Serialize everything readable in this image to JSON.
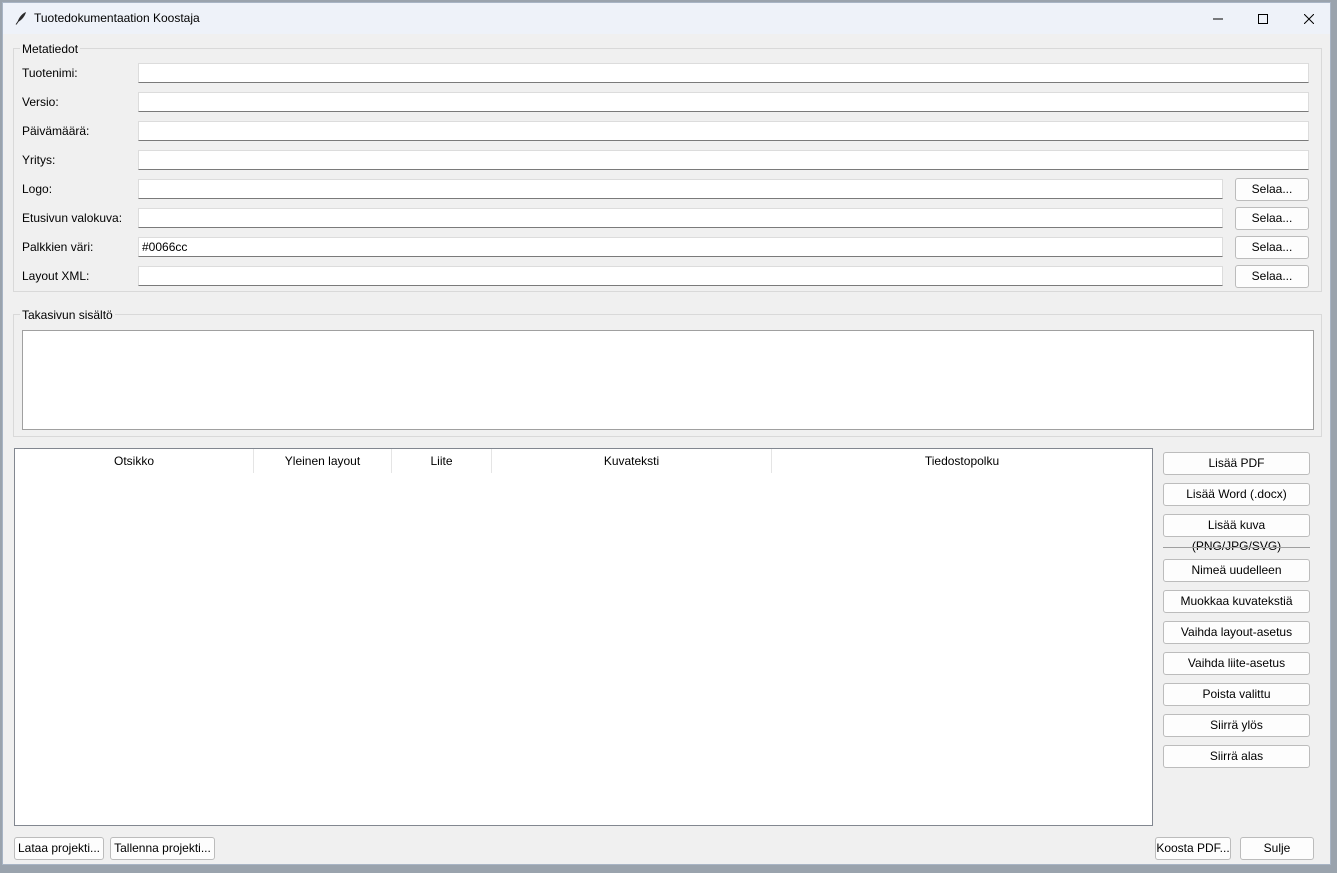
{
  "window": {
    "title": "Tuotedokumentaation Koostaja"
  },
  "metadata": {
    "group_label": "Metatiedot",
    "fields": [
      {
        "label": "Tuotenimi:",
        "value": ""
      },
      {
        "label": "Versio:",
        "value": ""
      },
      {
        "label": "Päivämäärä:",
        "value": ""
      },
      {
        "label": "Yritys:",
        "value": ""
      },
      {
        "label": "Logo:",
        "value": "",
        "browse": "Selaa..."
      },
      {
        "label": "Etusivun valokuva:",
        "value": "",
        "browse": "Selaa..."
      },
      {
        "label": "Palkkien väri:",
        "value": "#0066cc",
        "browse": "Selaa..."
      },
      {
        "label": "Layout XML:",
        "value": "",
        "browse": "Selaa..."
      }
    ]
  },
  "backpage": {
    "group_label": "Takasivun sisältö",
    "value": ""
  },
  "table": {
    "columns": [
      "Otsikko",
      "Yleinen layout",
      "Liite",
      "Kuvateksti",
      "Tiedostopolku"
    ],
    "rows": []
  },
  "side_buttons": {
    "add_pdf": "Lisää PDF",
    "add_word": "Lisää Word (.docx)",
    "add_image": "Lisää kuva (PNG/JPG/SVG)",
    "rename": "Nimeä uudelleen",
    "edit_caption": "Muokkaa kuvatekstiä",
    "toggle_layout": "Vaihda layout-asetus",
    "toggle_appendix": "Vaihda liite-asetus",
    "remove": "Poista valittu",
    "move_up": "Siirrä ylös",
    "move_down": "Siirrä alas"
  },
  "bottom_buttons": {
    "load": "Lataa projekti...",
    "save": "Tallenna projekti...",
    "build": "Koosta PDF...",
    "close": "Sulje"
  },
  "icons": {
    "app": "feather-icon",
    "minimize": "minimize-icon",
    "maximize": "maximize-icon",
    "close": "close-icon"
  }
}
